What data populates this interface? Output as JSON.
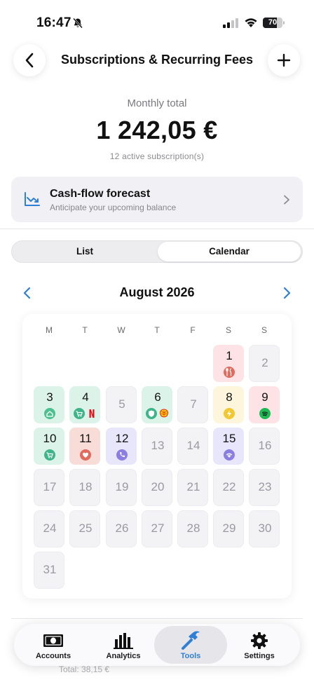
{
  "status_bar": {
    "time": "16:47",
    "battery_level": "70",
    "battery_fraction": 0.7
  },
  "header": {
    "title": "Subscriptions & Recurring Fees"
  },
  "summary": {
    "label": "Monthly total",
    "amount": "1 242,05 €",
    "count": "12 active subscription(s)"
  },
  "forecast": {
    "title": "Cash-flow forecast",
    "subtitle": "Anticipate your upcoming balance"
  },
  "view_toggle": {
    "options": [
      "List",
      "Calendar"
    ],
    "selected": "Calendar"
  },
  "calendar": {
    "month": "August 2026",
    "weekdays": [
      "M",
      "T",
      "W",
      "T",
      "F",
      "S",
      "S"
    ],
    "first_weekday_index": 5,
    "days_in_month": 31,
    "highlighted": {
      "1": {
        "tint": "#fde3e6",
        "chips": [
          {
            "icon": "fork-knife-icon",
            "color": "#e06a5c"
          }
        ]
      },
      "3": {
        "tint": "#dcf3ea",
        "chips": [
          {
            "icon": "house-icon",
            "color": "#4cc08e"
          }
        ]
      },
      "4": {
        "tint": "#dcf3ea",
        "chips": [
          {
            "icon": "cart-icon",
            "color": "#3fb38a"
          },
          {
            "icon": "netflix-icon",
            "color": "#e50914"
          }
        ]
      },
      "6": {
        "tint": "#dcf3ea",
        "chips": [
          {
            "icon": "shield-icon",
            "color": "#3fb38a"
          },
          {
            "icon": "shell-icon",
            "color": "#ffd200"
          }
        ]
      },
      "8": {
        "tint": "#fdf6dc",
        "chips": [
          {
            "icon": "bolt-icon",
            "color": "#f2c832"
          }
        ]
      },
      "9": {
        "tint": "#fde3e6",
        "chips": [
          {
            "icon": "spotify-icon",
            "color": "#1db954"
          }
        ]
      },
      "10": {
        "tint": "#dcf3ea",
        "chips": [
          {
            "icon": "cart-icon",
            "color": "#3fb38a"
          }
        ]
      },
      "11": {
        "tint": "#f8dcd8",
        "chips": [
          {
            "icon": "heart-icon",
            "color": "#e06a5c"
          }
        ]
      },
      "12": {
        "tint": "#e8e6fb",
        "chips": [
          {
            "icon": "phone-icon",
            "color": "#8a7fe0"
          }
        ]
      },
      "15": {
        "tint": "#e8e6fb",
        "chips": [
          {
            "icon": "wifi-icon",
            "color": "#8a7fe0"
          }
        ]
      }
    }
  },
  "below": {
    "partial_text": "Total: 38,15 €"
  },
  "tabbar": {
    "items": [
      {
        "label": "Accounts",
        "icon": "banknote-icon",
        "active": false
      },
      {
        "label": "Analytics",
        "icon": "bar-chart-icon",
        "active": false
      },
      {
        "label": "Tools",
        "icon": "hammer-icon",
        "active": true
      },
      {
        "label": "Settings",
        "icon": "gear-icon",
        "active": false
      }
    ]
  }
}
